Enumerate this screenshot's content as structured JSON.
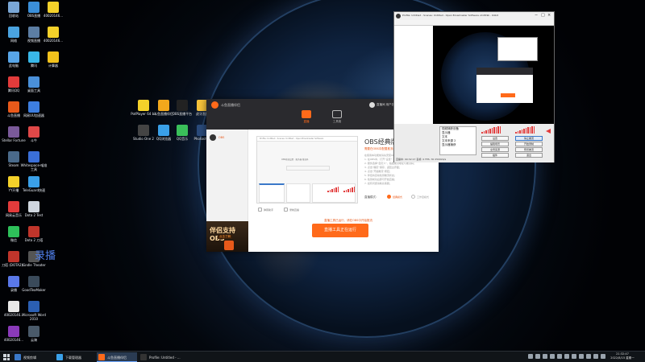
{
  "desktop_icons": [
    {
      "label": "回收站",
      "color": "#7aa7d6"
    },
    {
      "label": "OBS直播",
      "color": "#3b8fd9"
    },
    {
      "label": "40020146...",
      "color": "#f4d12a"
    },
    {
      "label": "网络",
      "color": "#4aa3e0"
    },
    {
      "label": "视频直播",
      "color": "#5c7ea4"
    },
    {
      "label": "40020146...",
      "color": "#f4d12a"
    },
    {
      "label": "此电脑",
      "color": "#58a6e8"
    },
    {
      "label": "腾讯",
      "color": "#39b7e8"
    },
    {
      "label": "计算器",
      "color": "#f2c21c"
    },
    {
      "label": "腾讯QQ",
      "color": "#e23b3b"
    },
    {
      "label": "桌面工具",
      "color": "#4a90d9"
    },
    {
      "label": "斗鱼直播",
      "color": "#e8591a"
    },
    {
      "label": "网易UU加速器",
      "color": "#3d7ee0"
    },
    {
      "label": "Stellar Fortune",
      "color": "#7a5a9a"
    },
    {
      "label": "斗牛",
      "color": "#e04848"
    },
    {
      "label": "Steam",
      "color": "#4a6a8a"
    },
    {
      "label": "Whitespace-喵准工具",
      "color": "#3a6fd8"
    },
    {
      "label": "YY开播",
      "color": "#f4d12a"
    },
    {
      "label": "TeleGuard快速",
      "color": "#3aa0e8"
    },
    {
      "label": "网易云音乐",
      "color": "#e23b3b"
    },
    {
      "label": "Dota 2 Test",
      "color": "#cfd6de"
    },
    {
      "label": "微信",
      "color": "#2ec05a"
    },
    {
      "label": "Dota 2 刀塔",
      "color": "#c0352b"
    },
    {
      "label": "刀塔 (DOTA2)...",
      "color": "#c0352b"
    },
    {
      "label": "Kindle Theater",
      "color": "#555"
    },
    {
      "label": "录播",
      "color": "#5a78e8"
    },
    {
      "label": "GoodTeaMaker",
      "color": "#3a4a5a"
    },
    {
      "label": "40020146...",
      "color": "#e8e8e8"
    },
    {
      "label": "Microsoft Word 2010",
      "color": "#2b5fb3"
    },
    {
      "label": "40020146...",
      "color": "#8a3ab9"
    },
    {
      "label": "云骑",
      "color": "#4a5a6a"
    },
    {
      "label": "40020146...",
      "color": "#8a3ab9"
    },
    {
      "label": "PotPlayer 64 bit",
      "color": "#f4d12a"
    },
    {
      "label": "斗鱼直播伴侣",
      "color": "#f2a81c"
    },
    {
      "label": "OBS直播平台",
      "color": "#222"
    },
    {
      "label": "虎牙直播",
      "color": "#f5c23a"
    },
    {
      "label": "Studio One 2",
      "color": "#444"
    },
    {
      "label": "QQ浏览器",
      "color": "#3aa0e8"
    },
    {
      "label": "QQ音乐",
      "color": "#3ac05a"
    },
    {
      "label": "Photoshop",
      "color": "#2a4a7a"
    }
  ],
  "overlay_text": "录播",
  "app": {
    "name": "斗鱼直播伴侣",
    "tabs": [
      {
        "label": "直播"
      },
      {
        "label": "工具箱"
      }
    ],
    "header_user": "直播间 用户名称...",
    "header_link": "我的直播间",
    "sidebar_item": "OBS",
    "promo_title": "伴侣支持OBS",
    "promo_sub": "点击了解",
    "preview_bar": "Profile: Untitled - Scenes: Untitled - Open Broadcaster Software",
    "preview_mid": "OBS推流设置 · 服务器 推流码",
    "main_title": "OBS经典版",
    "main_sub": "需要在OBS中配置推流地址",
    "desc_lines": [
      "在使用本功能前请先安装OBS直播软件并进行设置。",
      "1. 在OBS中，打开“设置”-“串流”选项卡；",
      "2. 服务选择“自定义”，粘贴推流地址与推流码；",
      "3. 点击“确定”保存，返回主界面；",
      "4. 点击“开始推流”按钮；",
      "5. 伴侣将自动检测推流状态；",
      "6. 检测成功后即可开始直播；",
      "7. 如有问题请联系客服。"
    ],
    "option_label": "直播模式：",
    "option_on": "经典模式",
    "option_off": "工作室模式",
    "check1": "弹幕助手",
    "check2": "录制直播",
    "warn": "直播工具已运行，请在OBS中开始推流",
    "start_button": "直播工具正在运行"
  },
  "obs": {
    "title": "Profile: Untitled - Scenes: Untitled - Open Broadcaster Software v0.659b - 64bit",
    "list": [
      "视频捕获设备",
      "显示器",
      "文本",
      "文本来源 2",
      "显示器捕获"
    ],
    "ctrls": [
      "设置",
      "停止推流",
      "编辑场景",
      "开始录制",
      "全局来源",
      "预览推流",
      "插件",
      "退出"
    ],
    "status": "直播中: 00:32:17  丢帧: 0  FPS: 30  2500kb/s"
  },
  "taskbar": {
    "items": [
      {
        "label": "视频剪辑",
        "color": "#3a78c8"
      },
      {
        "label": "下载管理器",
        "color": "#3aa0e8"
      },
      {
        "label": "斗鱼直播伴侣",
        "color": "#ff6a1a"
      },
      {
        "label": "Profile: Untitled - ...",
        "color": "#333"
      }
    ],
    "time": "21:32:47",
    "date": "2022/8/15 星期一"
  }
}
